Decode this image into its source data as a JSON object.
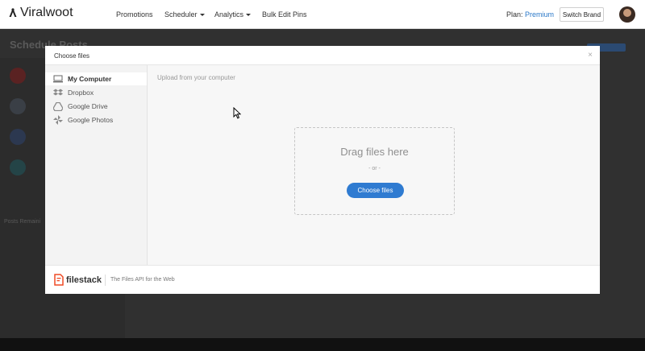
{
  "navbar": {
    "logo_text": "Viralwoot",
    "items": [
      {
        "label": "Promotions"
      },
      {
        "label": "Scheduler"
      },
      {
        "label": "Analytics"
      },
      {
        "label": "Bulk Edit Pins"
      }
    ],
    "plan_label": "Plan:",
    "plan_value": "Premium",
    "switch_brand_label": "Switch Brand"
  },
  "background_page": {
    "title": "Schedule Posts",
    "posts_label": "Posts Remaini"
  },
  "modal": {
    "title": "Choose files",
    "close_icon": "×",
    "sources": [
      {
        "label": "My Computer",
        "icon": "monitor-icon"
      },
      {
        "label": "Dropbox",
        "icon": "dropbox-icon"
      },
      {
        "label": "Google Drive",
        "icon": "google-drive-icon"
      },
      {
        "label": "Google Photos",
        "icon": "google-photos-icon"
      }
    ],
    "upload_label": "Upload from your computer",
    "drag_text": "Drag files here",
    "or_text": "- or -",
    "choose_button": "Choose files",
    "footer": {
      "brand": "filestack",
      "tagline": "The Files API for the Web"
    }
  },
  "colors": {
    "accent": "#2f7bd1",
    "plan_value": "#2a78c8",
    "filestack_logo": "#ef4a25"
  }
}
